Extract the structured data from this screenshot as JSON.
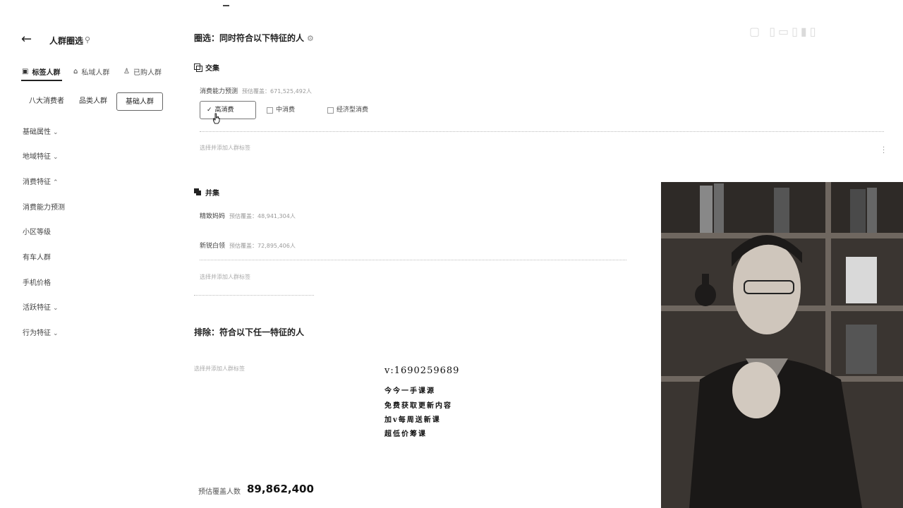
{
  "app": {
    "title": "人群圈选"
  },
  "toptabs": [
    {
      "label": "标签人群",
      "active": true
    },
    {
      "label": "私域人群",
      "active": false
    },
    {
      "label": "已购人群",
      "active": false
    }
  ],
  "subtabs": [
    {
      "label": "八大消费者",
      "selected": false
    },
    {
      "label": "品类人群",
      "selected": false
    },
    {
      "label": "基础人群",
      "selected": true
    }
  ],
  "sidebar": {
    "items": [
      {
        "label": "基础属性",
        "chevron": "chevron-down"
      },
      {
        "label": "地域特征",
        "chevron": "chevron-down"
      },
      {
        "label": "消费特征",
        "chevron": "chevron-up"
      },
      {
        "label": "消费能力预测",
        "chevron": ""
      },
      {
        "label": "小区等级",
        "chevron": ""
      },
      {
        "label": "有车人群",
        "chevron": ""
      },
      {
        "label": "手机价格",
        "chevron": ""
      },
      {
        "label": "活跃特征",
        "chevron": "chevron-down"
      },
      {
        "label": "行为特征",
        "chevron": "chevron-down"
      }
    ]
  },
  "main": {
    "heading": "圈选：同时符合以下特征的人",
    "intersect": {
      "label": "交集",
      "condition": {
        "title": "消费能力预测",
        "coverage": "预估覆盖：671,525,492人",
        "options": [
          {
            "label": "高消费",
            "selected": true
          },
          {
            "label": "中消费",
            "selected": false
          },
          {
            "label": "经济型消费",
            "selected": false
          }
        ]
      },
      "hint": "选择并添加人群标签"
    },
    "union": {
      "label": "并集",
      "conditions": [
        {
          "title": "精致妈妈",
          "coverage": "预估覆盖：48,941,304人"
        },
        {
          "title": "新锐白领",
          "coverage": "预估覆盖：72,895,406人"
        }
      ],
      "hint": "选择并添加人群标签"
    },
    "exclude": {
      "heading": "排除：符合以下任一特征的人",
      "hint": "选择并添加人群标签"
    }
  },
  "promo": {
    "contact": "v:1690259689",
    "lines": [
      "今今一手课源",
      "免费获取更新内容",
      "加v每周送新课",
      "超低价筹课"
    ]
  },
  "estimate": {
    "label": "预估覆盖人数",
    "value": "89,862,400"
  },
  "icons": {
    "back": "arrow-left-icon",
    "pin": "pin-icon",
    "settings": "gear-icon",
    "cursor": "hand-pointer-icon"
  },
  "colors": {
    "text": "#222222",
    "muted": "#999999",
    "border": "#777777"
  }
}
